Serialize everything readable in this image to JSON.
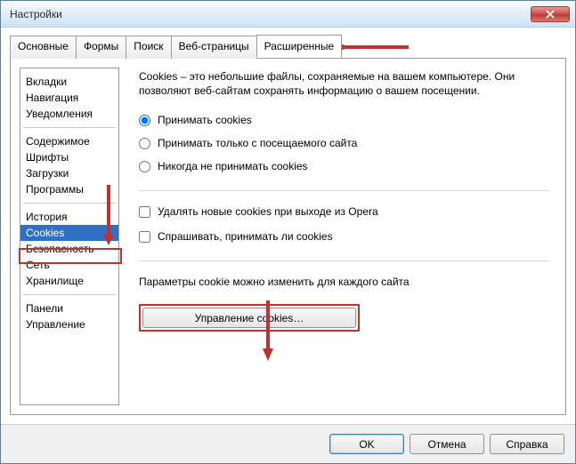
{
  "title": "Настройки",
  "tabs": [
    "Основные",
    "Формы",
    "Поиск",
    "Веб-страницы",
    "Расширенные"
  ],
  "active_tab_index": 4,
  "sidebar": {
    "groups": [
      [
        "Вкладки",
        "Навигация",
        "Уведомления"
      ],
      [
        "Содержимое",
        "Шрифты",
        "Загрузки",
        "Программы"
      ],
      [
        "История",
        "Cookies",
        "Безопасность",
        "Сеть",
        "Хранилище"
      ],
      [
        "Панели",
        "Управление"
      ]
    ],
    "selected": "Cookies"
  },
  "content": {
    "description": "Cookies – это небольшие файлы, сохраняемые на вашем компьютере. Они позволяют веб-сайтам сохранять информацию о вашем посещении.",
    "radios": [
      "Принимать cookies",
      "Принимать только с посещаемого сайта",
      "Никогда не принимать cookies"
    ],
    "radio_selected_index": 0,
    "checks": [
      {
        "label": "Удалять новые cookies при выходе из Opera",
        "checked": false
      },
      {
        "label": "Спрашивать, принимать ли cookies",
        "checked": false
      }
    ],
    "per_site_label": "Параметры cookie можно изменить для каждого сайта",
    "manage_button": "Управление cookies…"
  },
  "footer": {
    "ok": "OK",
    "cancel": "Отмена",
    "help": "Справка"
  }
}
